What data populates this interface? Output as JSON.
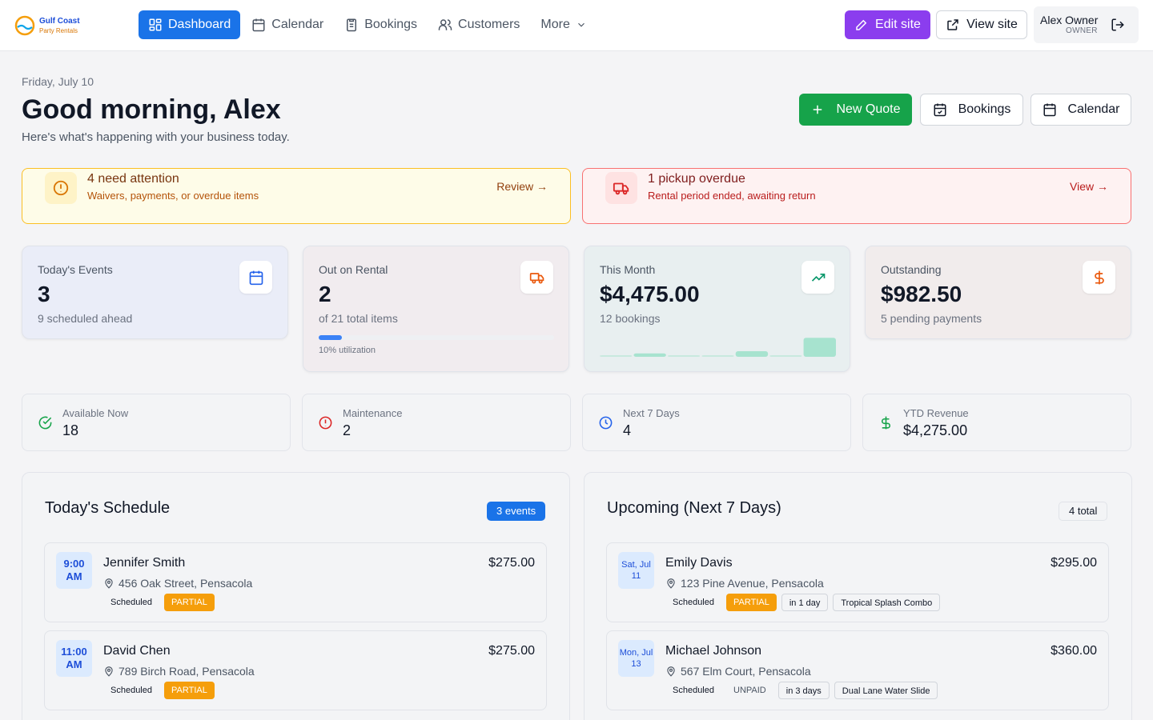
{
  "brand": {
    "line1": "Gulf Coast",
    "line2": "Party Rentals"
  },
  "nav": {
    "items": [
      {
        "label": "Dashboard"
      },
      {
        "label": "Calendar"
      },
      {
        "label": "Bookings"
      },
      {
        "label": "Customers"
      },
      {
        "label": "More"
      }
    ]
  },
  "header": {
    "edit_site": "Edit site",
    "view_site": "View site",
    "user_name": "Alex Owner",
    "user_role": "OWNER"
  },
  "page": {
    "date": "Friday, July 10",
    "greeting": "Good morning, Alex",
    "subtitle": "Here's what's happening with your business today."
  },
  "actions": {
    "new_quote": "New Quote",
    "bookings": "Bookings",
    "calendar": "Calendar"
  },
  "alerts": [
    {
      "title": "4 need attention",
      "desc": "Waivers, payments, or overdue items",
      "link": "Review →"
    },
    {
      "title": "1 pickup overdue",
      "desc": "Rental period ended, awaiting return",
      "link": "View →"
    }
  ],
  "stats": [
    {
      "label": "Today's Events",
      "value": "3",
      "note": "9 scheduled ahead"
    },
    {
      "label": "Out on Rental",
      "value": "2",
      "note": "of 21 total items",
      "progress_pct": 10,
      "util": "10% utilization"
    },
    {
      "label": "This Month",
      "value": "$4,475.00",
      "note": "12 bookings",
      "spark": [
        0,
        0.15,
        0,
        0,
        0.25,
        0,
        0.85
      ]
    },
    {
      "label": "Outstanding",
      "value": "$982.50",
      "note": "5 pending payments"
    }
  ],
  "mini": [
    {
      "label": "Available Now",
      "value": "18"
    },
    {
      "label": "Maintenance",
      "value": "2"
    },
    {
      "label": "Next 7 Days",
      "value": "4"
    },
    {
      "label": "YTD Revenue",
      "value": "$4,275.00"
    }
  ],
  "today": {
    "title": "Today's Schedule",
    "badge": "3 events",
    "items": [
      {
        "time": "9:00 AM",
        "name": "Jennifer Smith",
        "amount": "$275.00",
        "address": "456 Oak Street, Pensacola",
        "status": "Scheduled",
        "pay": "PARTIAL"
      },
      {
        "time": "11:00 AM",
        "name": "David Chen",
        "amount": "$275.00",
        "address": "789 Birch Road, Pensacola",
        "status": "Scheduled",
        "pay": "PARTIAL"
      }
    ]
  },
  "upcoming": {
    "title": "Upcoming (Next 7 Days)",
    "badge": "4 total",
    "items": [
      {
        "date": "Sat, Jul 11",
        "name": "Emily Davis",
        "amount": "$295.00",
        "address": "123 Pine Avenue, Pensacola",
        "status": "Scheduled",
        "pay": "PARTIAL",
        "when": "in 1 day",
        "item": "Tropical Splash Combo"
      },
      {
        "date": "Mon, Jul 13",
        "name": "Michael Johnson",
        "amount": "$360.00",
        "address": "567 Elm Court, Pensacola",
        "status": "Scheduled",
        "pay": "UNPAID",
        "when": "in 3 days",
        "item": "Dual Lane Water Slide"
      }
    ]
  },
  "colors": {
    "primary": "#1a73e8",
    "edit": "#8b3dee",
    "success": "#16a34a",
    "warning": "#f59e0b",
    "danger": "#dc2626"
  }
}
